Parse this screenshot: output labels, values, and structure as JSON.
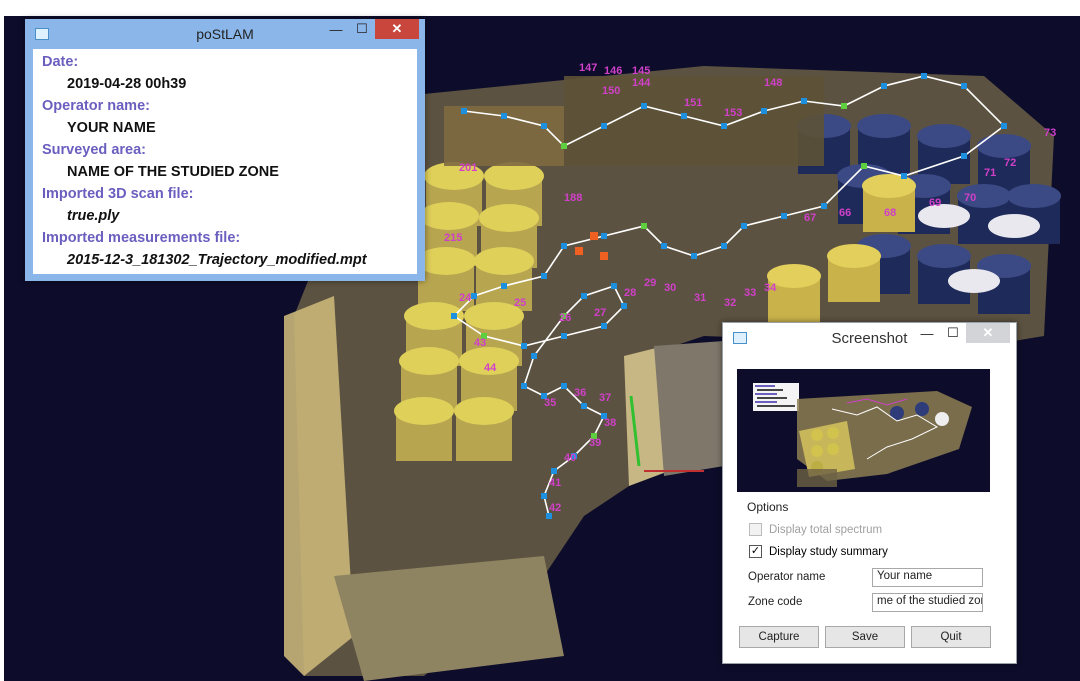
{
  "main_window": {
    "title": "poStLAM",
    "summary": {
      "date_label": "Date:",
      "date_value": "2019-04-28 00h39",
      "operator_label": "Operator name:",
      "operator_value": "YOUR NAME",
      "area_label": "Surveyed area:",
      "area_value": "NAME OF THE STUDIED ZONE",
      "scan_label": "Imported 3D scan file:",
      "scan_value": "true.ply",
      "measurements_label": "Imported measurements file:",
      "measurements_value": "2015-12-3_181302_Trajectory_modified.mpt"
    }
  },
  "screenshot_dialog": {
    "title": "Screenshot",
    "options_title": "Options",
    "display_total_spectrum": {
      "label": "Display total spectrum",
      "checked": false,
      "enabled": false
    },
    "display_study_summary": {
      "label": "Display study summary",
      "checked": true,
      "enabled": true
    },
    "operator_name_label": "Operator name",
    "operator_name_value": "Your name",
    "zone_code_label": "Zone code",
    "zone_code_value": "me of the studied zone",
    "buttons": {
      "capture": "Capture",
      "save": "Save",
      "quit": "Quit"
    }
  },
  "window_controls": {
    "minimize": "—",
    "maximize": "☐",
    "close": "✕"
  },
  "trajectory_labels": [
    "147",
    "146",
    "145",
    "150",
    "144",
    "151",
    "153",
    "148",
    "67",
    "66",
    "68",
    "69",
    "70",
    "71",
    "72",
    "73",
    "24",
    "25",
    "26",
    "27",
    "28",
    "29",
    "30",
    "31",
    "32",
    "33",
    "34",
    "35",
    "36",
    "37",
    "38",
    "39",
    "40",
    "41",
    "42",
    "43",
    "44",
    "215",
    "201",
    "188"
  ],
  "colors": {
    "viewport_bg": "#0d0d2b",
    "title_bar_blue": "#8ab6ea",
    "summary_label_purple": "#6a5fbf",
    "close_red": "#c9463d",
    "trajectory_node": "#1e90e0",
    "trajectory_label": "#d040c8"
  }
}
